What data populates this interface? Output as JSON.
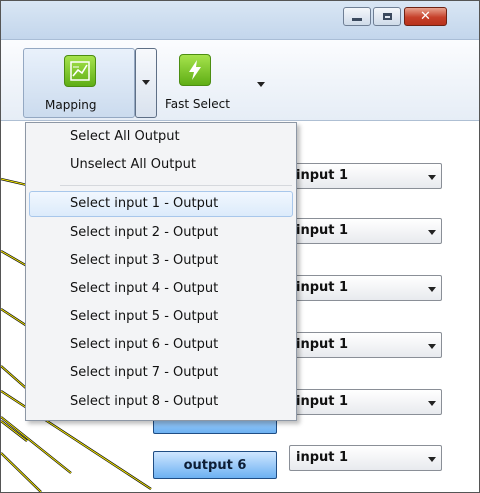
{
  "window": {
    "controls": {
      "minimize_icon": "minimize-icon",
      "maximize_icon": "maximize-icon",
      "close_icon": "close-icon",
      "close_glyph": "✕"
    }
  },
  "ribbon": {
    "mapping": {
      "label": "Mapping",
      "icon": "chart-icon"
    },
    "fast_select": {
      "label": "Fast Select",
      "icon": "lightning-icon"
    }
  },
  "mapping_menu": {
    "items": [
      "Select All Output",
      "Unselect All Output",
      "Select input 1 - Output",
      "Select input 2 - Output",
      "Select input 3 - Output",
      "Select input 4 - Output",
      "Select input 5 - Output",
      "Select input 6 - Output",
      "Select input 7 - Output",
      "Select input 8 - Output"
    ],
    "highlighted_index": 2
  },
  "routing_rows": [
    {
      "input": "input 1"
    },
    {
      "input": "input 1"
    },
    {
      "input": "input 1"
    },
    {
      "input": "input 1"
    },
    {
      "input": "input 1"
    },
    {
      "output": "output 6",
      "input": "input 1"
    }
  ],
  "colors": {
    "accent_green": "#6dbb1e",
    "output_button_blue": "#6cb1f2",
    "route_line_yellow": "#f3e600"
  }
}
